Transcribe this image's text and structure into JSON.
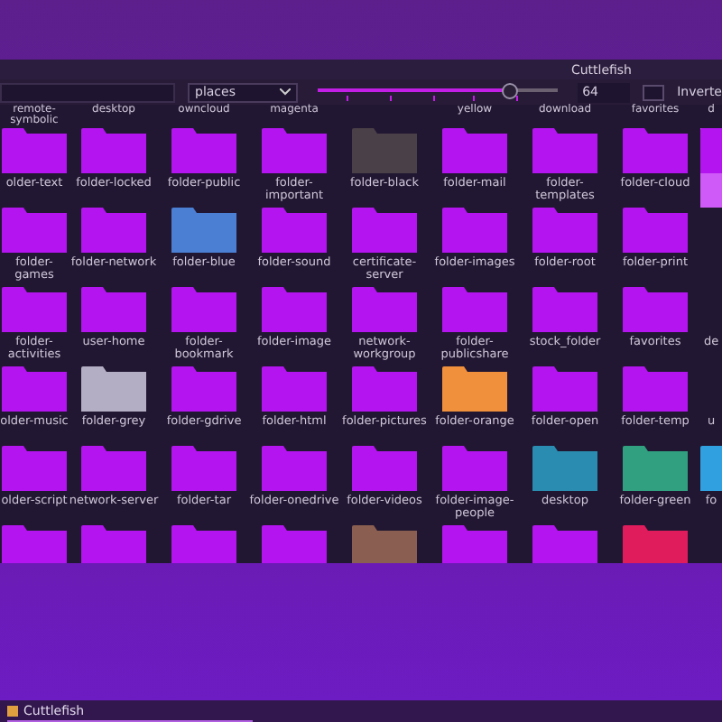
{
  "window": {
    "title": "Cuttlefish"
  },
  "toolbar": {
    "category": {
      "value": "places"
    },
    "size_slider": {
      "level": 0.81
    },
    "size_value": "64",
    "invert": {
      "checked": false,
      "label": "Inverte"
    }
  },
  "header_labels_left": [
    {
      "label": "remote-symbolic"
    },
    {
      "label": "desktop"
    },
    {
      "label": "owncloud"
    },
    {
      "label": "magenta"
    }
  ],
  "header_labels_right": [
    {
      "label": "yellow"
    },
    {
      "label": "download"
    },
    {
      "label": "favorites"
    },
    {
      "label": "d"
    }
  ],
  "rows": [
    [
      {
        "label": "older-text",
        "color": "#b414f0",
        "selected": false
      },
      {
        "label": "folder-locked",
        "color": "#b414f0",
        "selected": false
      },
      {
        "label": "folder-public",
        "color": "#b414f0",
        "selected": false
      },
      {
        "label": "folder-important",
        "color": "#b414f0",
        "selected": false
      },
      {
        "label": "folder-black",
        "color": "#4a4048",
        "selected": false
      },
      {
        "label": "folder-mail",
        "color": "#b414f0",
        "selected": false
      },
      {
        "label": "folder-templates",
        "color": "#b414f0",
        "selected": false
      },
      {
        "label": "folder-cloud",
        "color": "#b414f0",
        "selected": false
      },
      {
        "color": "#b414f0",
        "selected": true
      }
    ],
    [
      {
        "label": "folder-games",
        "color": "#b414f0",
        "selected": false
      },
      {
        "label": "folder-network",
        "color": "#b414f0",
        "selected": false
      },
      {
        "label": "folder-blue",
        "color": "#4a7fd4",
        "selected": false
      },
      {
        "label": "folder-sound",
        "color": "#b414f0",
        "selected": false
      },
      {
        "label": "certificate-server",
        "color": "#b414f0",
        "selected": false
      },
      {
        "label": "folder-images",
        "color": "#b414f0",
        "selected": false
      },
      {
        "label": "folder-root",
        "color": "#b414f0",
        "selected": false
      },
      {
        "label": "folder-print",
        "color": "#b414f0",
        "selected": false
      }
    ],
    [
      {
        "label": "folder-activities",
        "color": "#b414f0",
        "selected": false
      },
      {
        "label": "user-home",
        "color": "#b414f0",
        "selected": false
      },
      {
        "label": "folder-bookmark",
        "color": "#b414f0",
        "selected": false
      },
      {
        "label": "folder-image",
        "color": "#b414f0",
        "selected": false
      },
      {
        "label": "network-workgroup",
        "color": "#b414f0",
        "selected": false
      },
      {
        "label": "folder-publicshare",
        "color": "#b414f0",
        "selected": false
      },
      {
        "label": "stock_folder",
        "color": "#b414f0",
        "selected": false
      },
      {
        "label": "favorites",
        "color": "#b414f0",
        "selected": false
      },
      {
        "label": "de",
        "selected": false
      }
    ],
    [
      {
        "label": "older-music",
        "color": "#b414f0",
        "selected": false
      },
      {
        "label": "folder-grey",
        "color": "#b4aec4",
        "selected": false
      },
      {
        "label": "folder-gdrive",
        "color": "#b414f0",
        "selected": false
      },
      {
        "label": "folder-html",
        "color": "#b414f0",
        "selected": false
      },
      {
        "label": "folder-pictures",
        "color": "#b414f0",
        "selected": false
      },
      {
        "label": "folder-orange",
        "color": "#f0903c",
        "selected": false
      },
      {
        "label": "folder-open",
        "color": "#b414f0",
        "selected": false
      },
      {
        "label": "folder-temp",
        "color": "#b414f0",
        "selected": false
      },
      {
        "label": "u",
        "selected": false
      }
    ],
    [
      {
        "label": "older-script",
        "color": "#b414f0",
        "selected": false
      },
      {
        "label": "network-server",
        "color": "#b414f0",
        "selected": false
      },
      {
        "label": "folder-tar",
        "color": "#b414f0",
        "selected": false
      },
      {
        "label": "folder-onedrive",
        "color": "#b414f0",
        "selected": false
      },
      {
        "label": "folder-videos",
        "color": "#b414f0",
        "selected": false
      },
      {
        "label": "folder-image-people",
        "color": "#b414f0",
        "selected": false
      },
      {
        "label": "desktop",
        "color": "#2a8cb0",
        "selected": false
      },
      {
        "label": "folder-green",
        "color": "#30a080",
        "selected": false
      },
      {
        "label": "fo",
        "color": "#30a0e0",
        "selected": false
      }
    ],
    [
      {
        "color": "#b414f0",
        "selected": false
      },
      {
        "color": "#b414f0",
        "selected": false
      },
      {
        "color": "#b414f0",
        "selected": false
      },
      {
        "color": "#b414f0",
        "selected": false
      },
      {
        "color": "#8a5e50",
        "selected": false
      },
      {
        "color": "#b414f0",
        "selected": false
      },
      {
        "color": "#b414f0",
        "selected": false
      },
      {
        "color": "#e01c5c",
        "selected": false
      }
    ]
  ],
  "taskbar": {
    "task": "Cuttlefish"
  }
}
